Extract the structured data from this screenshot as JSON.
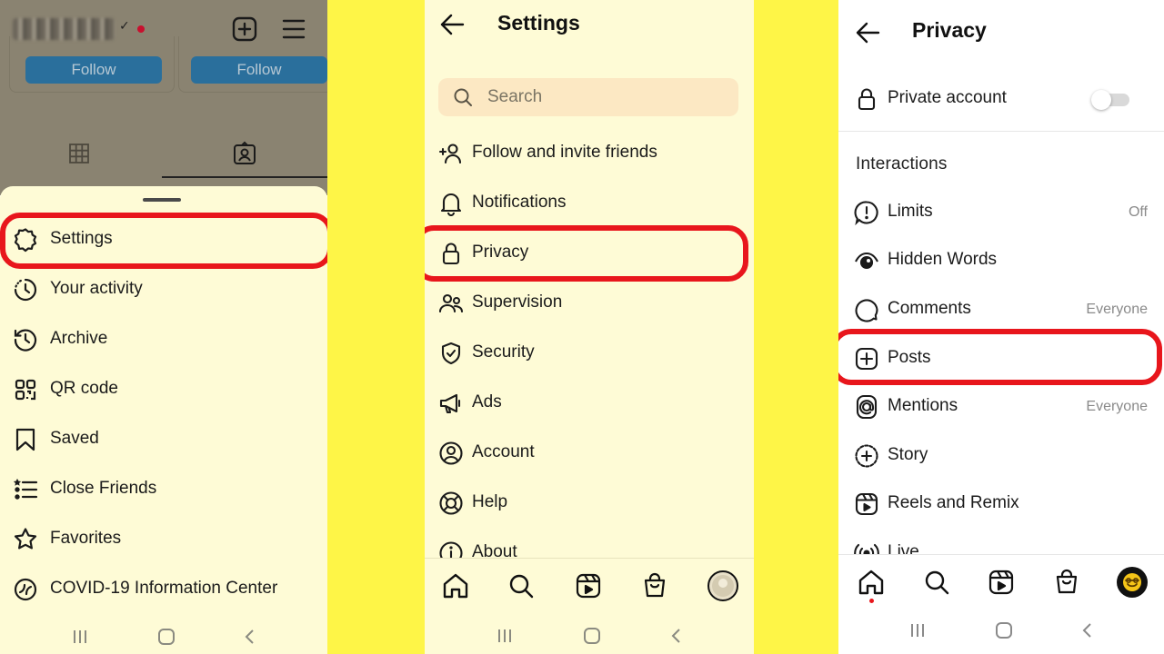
{
  "panel1": {
    "follow_buttons": [
      "Follow",
      "Follow"
    ],
    "menu": [
      {
        "label": "Settings",
        "icon": "settings-gear-icon"
      },
      {
        "label": "Your activity",
        "icon": "activity-clock-icon"
      },
      {
        "label": "Archive",
        "icon": "archive-history-icon"
      },
      {
        "label": "QR code",
        "icon": "qr-code-icon"
      },
      {
        "label": "Saved",
        "icon": "bookmark-icon"
      },
      {
        "label": "Close Friends",
        "icon": "close-friends-list-icon"
      },
      {
        "label": "Favorites",
        "icon": "star-icon"
      },
      {
        "label": "COVID-19 Information Center",
        "icon": "covid-info-icon"
      }
    ],
    "highlighted": "Settings"
  },
  "panel2": {
    "title": "Settings",
    "search_placeholder": "Search",
    "menu": [
      {
        "label": "Follow and invite friends",
        "icon": "add-person-icon"
      },
      {
        "label": "Notifications",
        "icon": "bell-icon"
      },
      {
        "label": "Privacy",
        "icon": "lock-icon"
      },
      {
        "label": "Supervision",
        "icon": "supervision-people-icon"
      },
      {
        "label": "Security",
        "icon": "shield-check-icon"
      },
      {
        "label": "Ads",
        "icon": "megaphone-icon"
      },
      {
        "label": "Account",
        "icon": "account-circle-icon"
      },
      {
        "label": "Help",
        "icon": "lifebuoy-icon"
      },
      {
        "label": "About",
        "icon": "info-icon"
      }
    ],
    "highlighted": "Privacy",
    "bottom_nav": [
      "home-icon",
      "search-icon",
      "reels-icon",
      "shop-icon",
      "profile-avatar"
    ]
  },
  "panel3": {
    "title": "Privacy",
    "private_account": {
      "label": "Private account",
      "enabled": false
    },
    "section_title": "Interactions",
    "menu": [
      {
        "label": "Limits",
        "value": "Off",
        "icon": "limits-alert-icon"
      },
      {
        "label": "Hidden Words",
        "value": "",
        "icon": "hidden-words-eye-icon"
      },
      {
        "label": "Comments",
        "value": "Everyone",
        "icon": "comment-bubble-icon"
      },
      {
        "label": "Posts",
        "value": "",
        "icon": "posts-plus-square-icon"
      },
      {
        "label": "Mentions",
        "value": "Everyone",
        "icon": "at-sign-icon"
      },
      {
        "label": "Story",
        "value": "",
        "icon": "story-plus-icon"
      },
      {
        "label": "Reels and Remix",
        "value": "",
        "icon": "reels-icon"
      },
      {
        "label": "Live",
        "value": "",
        "icon": "live-broadcast-icon"
      }
    ],
    "highlighted": "Posts",
    "bottom_nav": [
      "home-icon",
      "search-icon",
      "reels-icon",
      "shop-icon",
      "profile-avatar"
    ]
  },
  "colors": {
    "background_yellow": "#fef547",
    "panel_cream": "#fefbd6",
    "highlight_red": "#e8161c",
    "follow_blue": "#2a6f9c"
  }
}
